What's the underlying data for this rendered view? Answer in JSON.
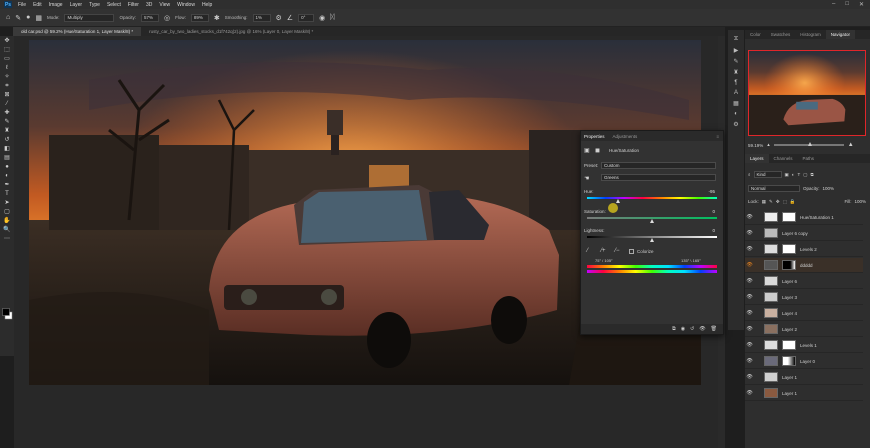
{
  "menu": {
    "logo": "Ps",
    "items": [
      "File",
      "Edit",
      "Image",
      "Layer",
      "Type",
      "Select",
      "Filter",
      "3D",
      "View",
      "Window",
      "Help"
    ]
  },
  "options": {
    "mode_label": "Mode:",
    "mode_value": "Multiply",
    "opacity_label": "Opacity:",
    "opacity_value": "57%",
    "flow_label": "Flow:",
    "flow_value": "89%",
    "smoothing_label": "Smoothing:",
    "smoothing_value": "1%",
    "angle_value": "0°"
  },
  "tabs": [
    {
      "label": "old car.psd @ 59.2% (Hue/Saturation 1, Layer Mask/8) *",
      "active": true
    },
    {
      "label": "rusty_car_by_two_ladies_stocks_d1f742q(2).jpg @ 16% (Layer 0, Layer Mask/8) *",
      "active": false
    }
  ],
  "right_tabs": [
    "Color",
    "Swatches",
    "Histogram",
    "Navigator"
  ],
  "navigator": {
    "zoom": "59.19%"
  },
  "layers_panel": {
    "tabs": [
      "Layers",
      "Channels",
      "Paths"
    ],
    "kind": "Kind",
    "blend": "Normal",
    "opacity_label": "Opacity:",
    "opacity_value": "100%",
    "lock_label": "Lock:",
    "fill_label": "Fill:",
    "fill_value": "100%",
    "layers": [
      {
        "name": "Hue/Saturation 1",
        "selected": true,
        "mask": true
      },
      {
        "name": "Layer 6 copy",
        "selected": false,
        "mask": false
      },
      {
        "name": "Levels 2",
        "selected": false,
        "mask": true
      },
      {
        "name": "ddddd",
        "selected": false,
        "mask": true
      },
      {
        "name": "Layer 6",
        "selected": false,
        "mask": false
      },
      {
        "name": "Layer 3",
        "selected": false,
        "mask": false
      },
      {
        "name": "Layer 4",
        "selected": false,
        "mask": false
      },
      {
        "name": "Layer 2",
        "selected": false,
        "mask": false
      },
      {
        "name": "Levels 1",
        "selected": false,
        "mask": true
      },
      {
        "name": "Layer 0",
        "selected": false,
        "mask": true
      },
      {
        "name": "Layer 1",
        "selected": false,
        "mask": false
      },
      {
        "name": "Layer 1",
        "selected": false,
        "mask": false
      }
    ]
  },
  "properties": {
    "tab_properties": "Properties",
    "tab_adjustments": "Adjustments",
    "title": "Hue/Saturation",
    "preset_label": "Preset:",
    "preset_value": "Custom",
    "channel_value": "Greens",
    "hue_label": "Hue:",
    "hue_value": "-95",
    "hue_level": -95,
    "saturation_label": "Saturation:",
    "saturation_value": "0",
    "saturation_level": 0,
    "lightness_label": "Lightness:",
    "lightness_value": "0",
    "lightness_level": 0,
    "colorize_label": "Colorize",
    "range_left": "75° / 105°",
    "range_right": "135° \\ 165°"
  }
}
